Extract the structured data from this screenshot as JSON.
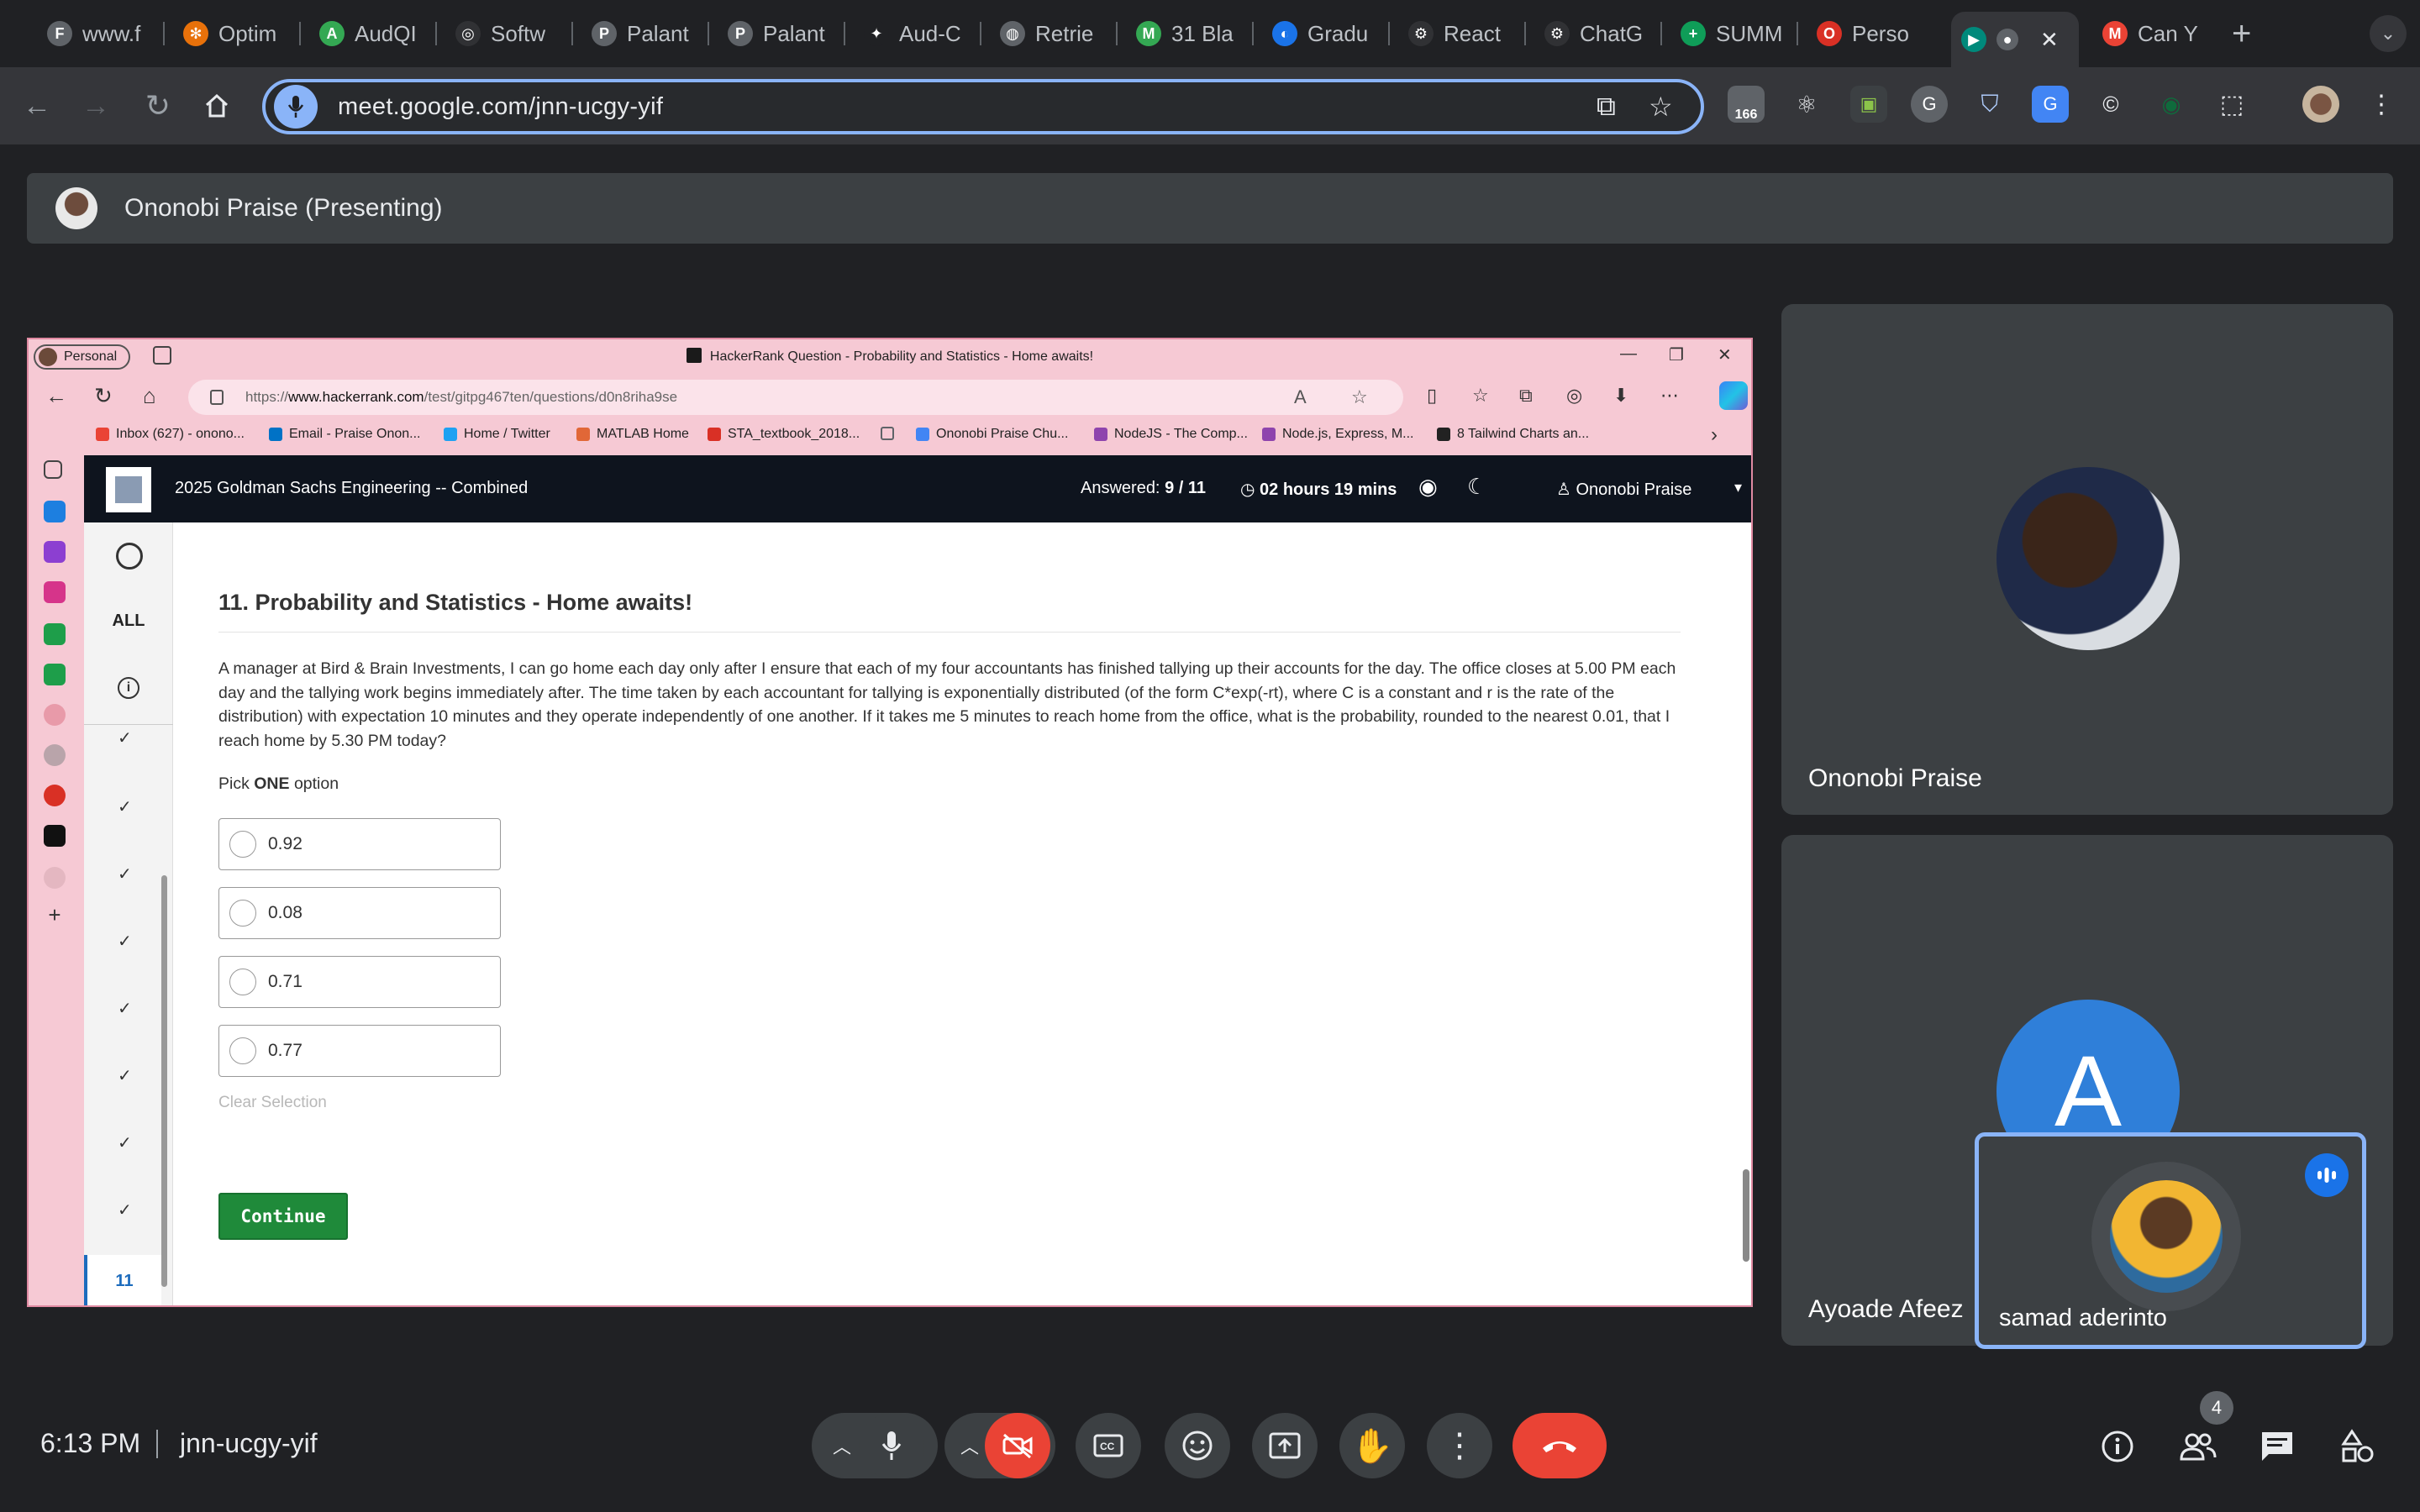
{
  "chrome": {
    "tabs": [
      {
        "label": "www.f",
        "color": "#5f6368",
        "glyph": "F"
      },
      {
        "label": "Optim",
        "color": "#e8710a",
        "glyph": "✻"
      },
      {
        "label": "AudQI",
        "color": "#34a853",
        "glyph": "A"
      },
      {
        "label": "Softw",
        "color": "#303134",
        "glyph": "◎"
      },
      {
        "label": "Palant",
        "color": "#5f6368",
        "glyph": "P"
      },
      {
        "label": "Palant",
        "color": "#5f6368",
        "glyph": "P"
      },
      {
        "label": "Aud-C",
        "color": "#202124",
        "glyph": "✦"
      },
      {
        "label": "Retrie",
        "color": "#5f6368",
        "glyph": "◍"
      },
      {
        "label": "31 Bla",
        "color": "#34a853",
        "glyph": "M"
      },
      {
        "label": "Gradu",
        "color": "#1a73e8",
        "glyph": "◐"
      },
      {
        "label": "React",
        "color": "#303134",
        "glyph": "⚙"
      },
      {
        "label": "ChatG",
        "color": "#303134",
        "glyph": "⚙"
      },
      {
        "label": "SUMM",
        "color": "#0f9d58",
        "glyph": "+"
      },
      {
        "label": "Perso",
        "color": "#d93025",
        "glyph": "O"
      },
      {
        "label": "",
        "color": "#00897b",
        "glyph": "▶"
      },
      {
        "label": "Can Y",
        "color": "#ea4335",
        "glyph": "M"
      }
    ],
    "url": "meet.google.com/jnn-ucgy-yif",
    "ext_badge": "166"
  },
  "meet": {
    "presenting_label": "Ononobi Praise (Presenting)",
    "participants": [
      {
        "name": "Ononobi Praise"
      },
      {
        "name": "Ayoade Afeez",
        "initial": "A"
      },
      {
        "name": "samad aderinto"
      }
    ],
    "time": "6:13 PM",
    "meeting_code": "jnn-ucgy-yif",
    "people_count": "4",
    "accent": "#8ab4f8",
    "end_call_color": "#ea4335"
  },
  "shared_browser": {
    "profile": "Personal",
    "window_title": "HackerRank Question - Probability and Statistics - Home awaits!",
    "url_prefix": "https://",
    "url_domain": "www.hackerrank.com",
    "url_path": "/test/gitpg467ten/questions/d0n8riha9se",
    "bookmarks": [
      {
        "label": "Inbox (627) - onono...",
        "color": "#ea4335"
      },
      {
        "label": "Email - Praise Onon...",
        "color": "#0072c6"
      },
      {
        "label": "Home / Twitter",
        "color": "#1da1f2"
      },
      {
        "label": "MATLAB Home",
        "color": "#e16737"
      },
      {
        "label": "STA_textbook_2018...",
        "color": "#d93025"
      },
      {
        "label": "",
        "color": "#5f6368"
      },
      {
        "label": "Ononobi Praise Chu...",
        "color": "#4285f4"
      },
      {
        "label": "NodeJS - The Comp...",
        "color": "#8e44ad"
      },
      {
        "label": "Node.js, Express, M...",
        "color": "#8e44ad"
      },
      {
        "label": "8 Tailwind Charts an...",
        "color": "#222222"
      }
    ]
  },
  "hackerrank": {
    "test_name": "2025 Goldman Sachs Engineering -- Combined",
    "answered_label": "Answered:",
    "answered_value": "9 / 11",
    "time_left": "02 hours 19 mins",
    "user": "Ononobi Praise",
    "all_label": "ALL",
    "current_question": "11",
    "question_title": "11. Probability and Statistics - Home awaits!",
    "question_body": "A manager at Bird & Brain Investments, I can go home each day only after I ensure that each of my four accountants has finished tallying up their accounts for the day. The office closes at 5.00 PM each day and the tallying work begins immediately after. The time taken by each accountant for tallying is exponentially distributed (of the form C*exp(-rt), where C is a constant and r is the rate of the distribution)  with expectation 10 minutes and they operate independently of one another. If it takes me 5 minutes to reach home from the office, what is the probability, rounded to the nearest 0.01, that I reach home by 5.30 PM today?",
    "pick_prefix": "Pick ",
    "pick_one": "ONE",
    "pick_suffix": " option",
    "options": [
      "0.92",
      "0.08",
      "0.71",
      "0.77"
    ],
    "clear_selection": "Clear Selection",
    "continue_label": "Continue"
  }
}
